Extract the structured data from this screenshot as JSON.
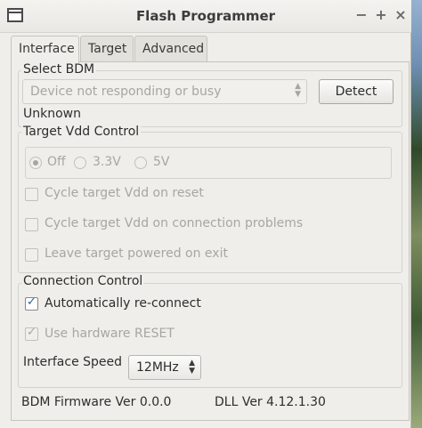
{
  "window": {
    "title": "Flash Programmer",
    "controls": {
      "minimize": "−",
      "maximize": "+",
      "close": "×"
    }
  },
  "tabs": [
    {
      "label": "Interface",
      "active": true
    },
    {
      "label": "Target",
      "active": false
    },
    {
      "label": "Advanced",
      "active": false
    }
  ],
  "select_bdm": {
    "title": "Select BDM",
    "device_combo_value": "Device not responding or busy",
    "detect_label": "Detect",
    "status": "Unknown"
  },
  "vdd_control": {
    "title": "Target Vdd Control",
    "options": [
      {
        "label": "Off",
        "selected": true
      },
      {
        "label": "3.3V",
        "selected": false
      },
      {
        "label": "5V",
        "selected": false
      }
    ],
    "cycle_on_reset": {
      "label": "Cycle target Vdd on reset",
      "checked": false
    },
    "cycle_on_connection": {
      "label": "Cycle target Vdd on connection problems",
      "checked": false
    },
    "leave_powered": {
      "label": "Leave target powered on exit",
      "checked": false
    }
  },
  "connection_control": {
    "title": "Connection Control",
    "auto_reconnect": {
      "label": "Automatically re-connect",
      "checked": true
    },
    "hardware_reset": {
      "label": "Use hardware RESET",
      "checked": true
    },
    "interface_speed_label": "Interface Speed",
    "interface_speed_value": "12MHz"
  },
  "footer": {
    "firmware": "BDM Firmware Ver 0.0.0",
    "dll": "DLL Ver 4.12.1.30"
  },
  "colors": {
    "window_bg": "#efeeea",
    "disabled_text": "#a8a6a1",
    "check_accent": "#2a5f9e"
  }
}
